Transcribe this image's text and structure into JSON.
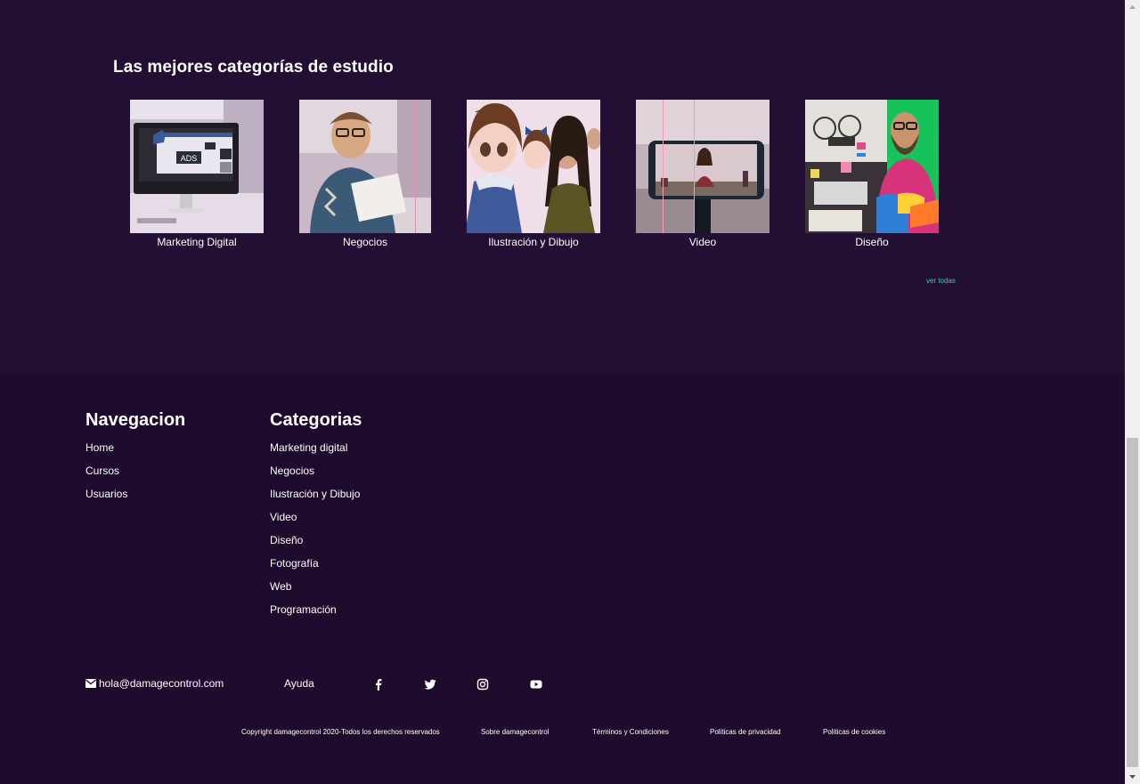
{
  "categories_section": {
    "title": "Las mejores categorías de estudio",
    "items": [
      {
        "label": "Marketing Digital"
      },
      {
        "label": "Negocios"
      },
      {
        "label": "Ilustración y Dibujo"
      },
      {
        "label": "Video"
      },
      {
        "label": "Diseño"
      }
    ],
    "see_all": "ver todas",
    "see_all_color": "#2bd4b4"
  },
  "footer": {
    "navigation": {
      "title": "Navegacion",
      "links": [
        "Home",
        "Cursos",
        "Usuarios"
      ]
    },
    "categories": {
      "title": "Categorias",
      "links": [
        "Marketing digital",
        "Negocios",
        "Ilustración y Dibujo",
        "Video",
        "Diseño",
        "Fotografía",
        "Web",
        "Programación"
      ]
    },
    "contact": {
      "email": "hola@damagecontrol.com",
      "email_icon": "envelope-icon",
      "help": "Ayuda",
      "socials": [
        "facebook-icon",
        "twitter-icon",
        "instagram-icon",
        "youtube-icon"
      ]
    },
    "legal": {
      "copyright": "Copyright damagecontrol 2020-Todos los derechos reservados",
      "about": "Sobre damagecontrol",
      "terms": "Términos y Condiciones",
      "privacy": "Politicas de privacidad",
      "cookies": "Politicas de cookies"
    }
  },
  "colors": {
    "section_bg": "#220f33",
    "footer_bg": "#1e0a2c",
    "accent": "#2bd4b4"
  }
}
